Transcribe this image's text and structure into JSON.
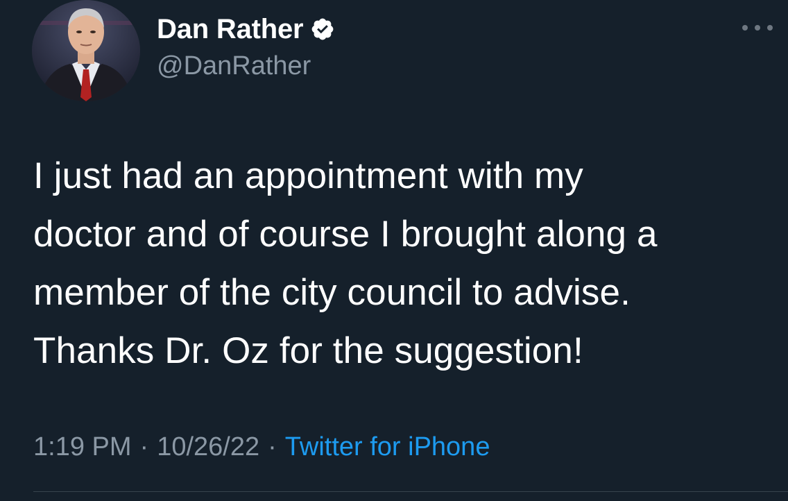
{
  "author": {
    "display_name": "Dan Rather",
    "handle": "@DanRather",
    "verified": true
  },
  "icons": {
    "verified": "verified-badge-icon",
    "more": "more-options-icon"
  },
  "tweet": {
    "text": "I just had an appointment with my\ndoctor and of course I brought along a\nmember of the city council to advise.\nThanks Dr. Oz for the suggestion!",
    "time": "1:19 PM",
    "separator": "·",
    "date": "10/26/22",
    "source": "Twitter for iPhone"
  },
  "colors": {
    "background": "#15202b",
    "text": "#ffffff",
    "secondary": "#8b98a5",
    "link": "#1d9bf0"
  }
}
